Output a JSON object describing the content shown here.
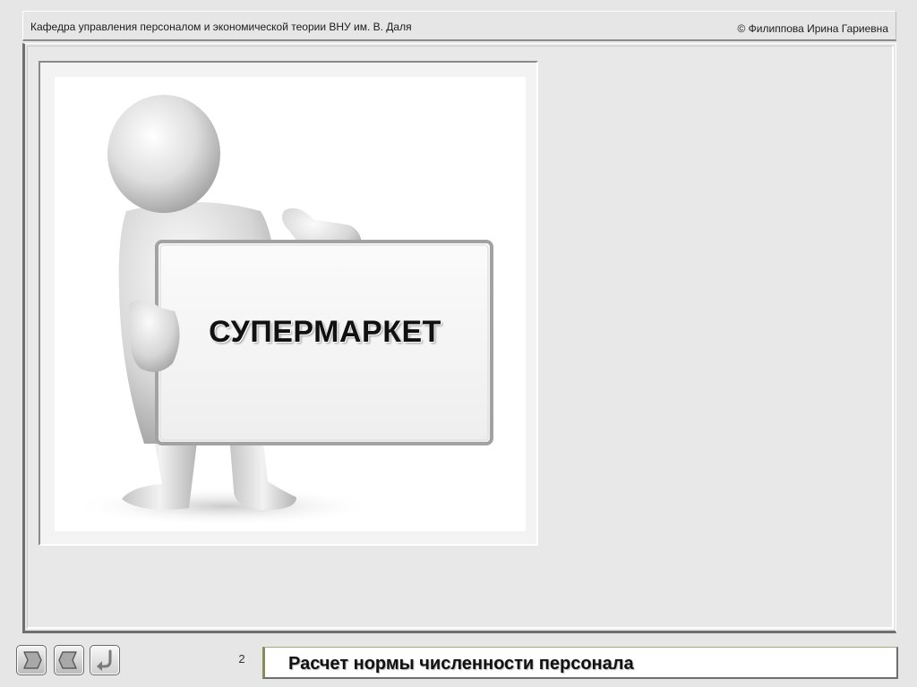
{
  "header": {
    "left_text": "Кафедра управления персоналом и экономической теории ВНУ им. В. Даля",
    "right_text": "© Филиппова Ирина Гариевна"
  },
  "slide": {
    "sign_text": "СУПЕРМАРКЕТ",
    "illustration": "3d-figure-holding-sign"
  },
  "footer": {
    "page_number": "2",
    "title": "Расчет нормы численности персонала",
    "nav": [
      {
        "name": "next",
        "icon": "chevron-right-icon"
      },
      {
        "name": "previous",
        "icon": "chevron-left-icon"
      },
      {
        "name": "return",
        "icon": "return-arrow-icon"
      }
    ]
  },
  "colors": {
    "background": "#e6e6e6",
    "frame_dark": "#6f6f6f",
    "title_accent": "#8a8a5a"
  }
}
